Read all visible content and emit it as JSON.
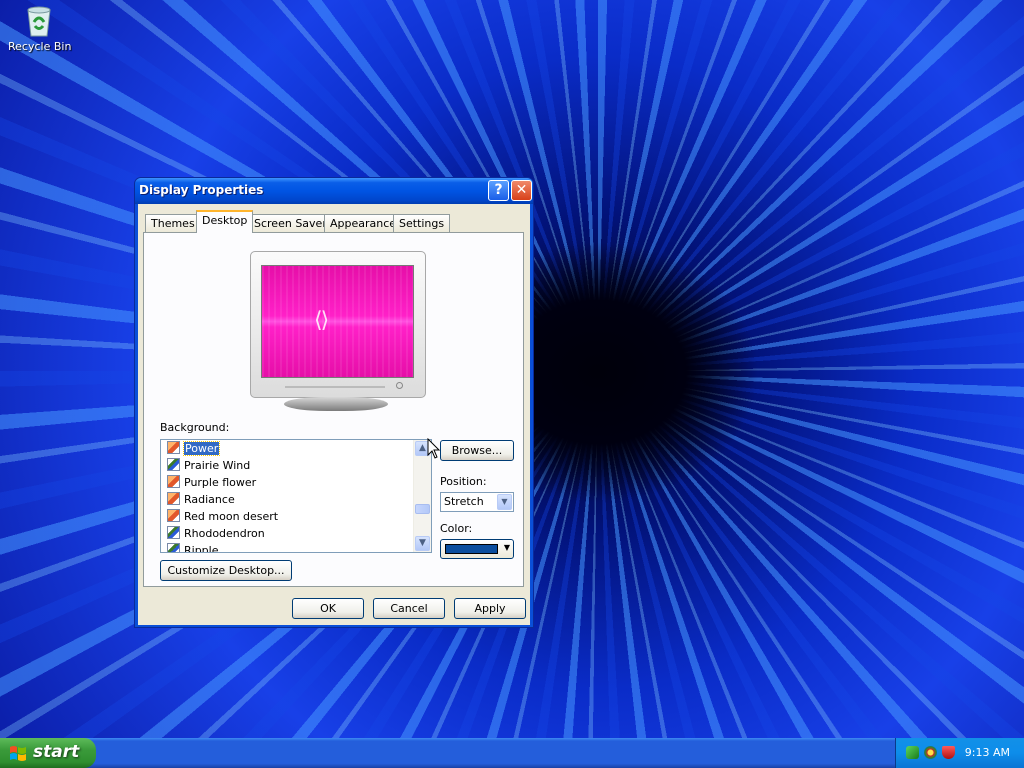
{
  "desktop": {
    "icons": [
      {
        "label": "Recycle Bin",
        "icon": "recycle-bin-icon"
      }
    ]
  },
  "window": {
    "title": "Display Properties",
    "title_buttons": [
      "help",
      "close"
    ],
    "tabs": [
      {
        "label": "Themes",
        "active": false
      },
      {
        "label": "Desktop",
        "active": true
      },
      {
        "label": "Screen Saver",
        "active": false
      },
      {
        "label": "Appearance",
        "active": false
      },
      {
        "label": "Settings",
        "active": false
      }
    ],
    "background_label": "Background:",
    "backgrounds": [
      {
        "label": "Power",
        "icon": "bitmap-icon",
        "selected": true
      },
      {
        "label": "Prairie Wind",
        "icon": "jpeg-image-icon",
        "selected": false
      },
      {
        "label": "Purple flower",
        "icon": "bitmap-icon",
        "selected": false
      },
      {
        "label": "Radiance",
        "icon": "bitmap-icon",
        "selected": false
      },
      {
        "label": "Red moon desert",
        "icon": "bitmap-icon",
        "selected": false
      },
      {
        "label": "Rhododendron",
        "icon": "jpeg-image-icon",
        "selected": false
      },
      {
        "label": "Ripple",
        "icon": "jpeg-image-icon",
        "selected": false
      }
    ],
    "browse_label": "Browse...",
    "position_label": "Position:",
    "position_value": "Stretch",
    "color_label": "Color:",
    "color_value": "#0b4e9e",
    "customize_label": "Customize Desktop...",
    "ok_label": "OK",
    "cancel_label": "Cancel",
    "apply_label": "Apply"
  },
  "taskbar": {
    "start_label": "start",
    "clock": "9:13 AM",
    "tray_icons": [
      "network-icon",
      "security-center-icon",
      "shield-alert-icon"
    ]
  },
  "colors": {
    "title_bar": "#0054e3",
    "dialog_face": "#ece9d8",
    "selection": "#316ac5",
    "taskbar": "#245edb",
    "start_button": "#3a9a3a",
    "preview_screen": "#ff20c8"
  }
}
